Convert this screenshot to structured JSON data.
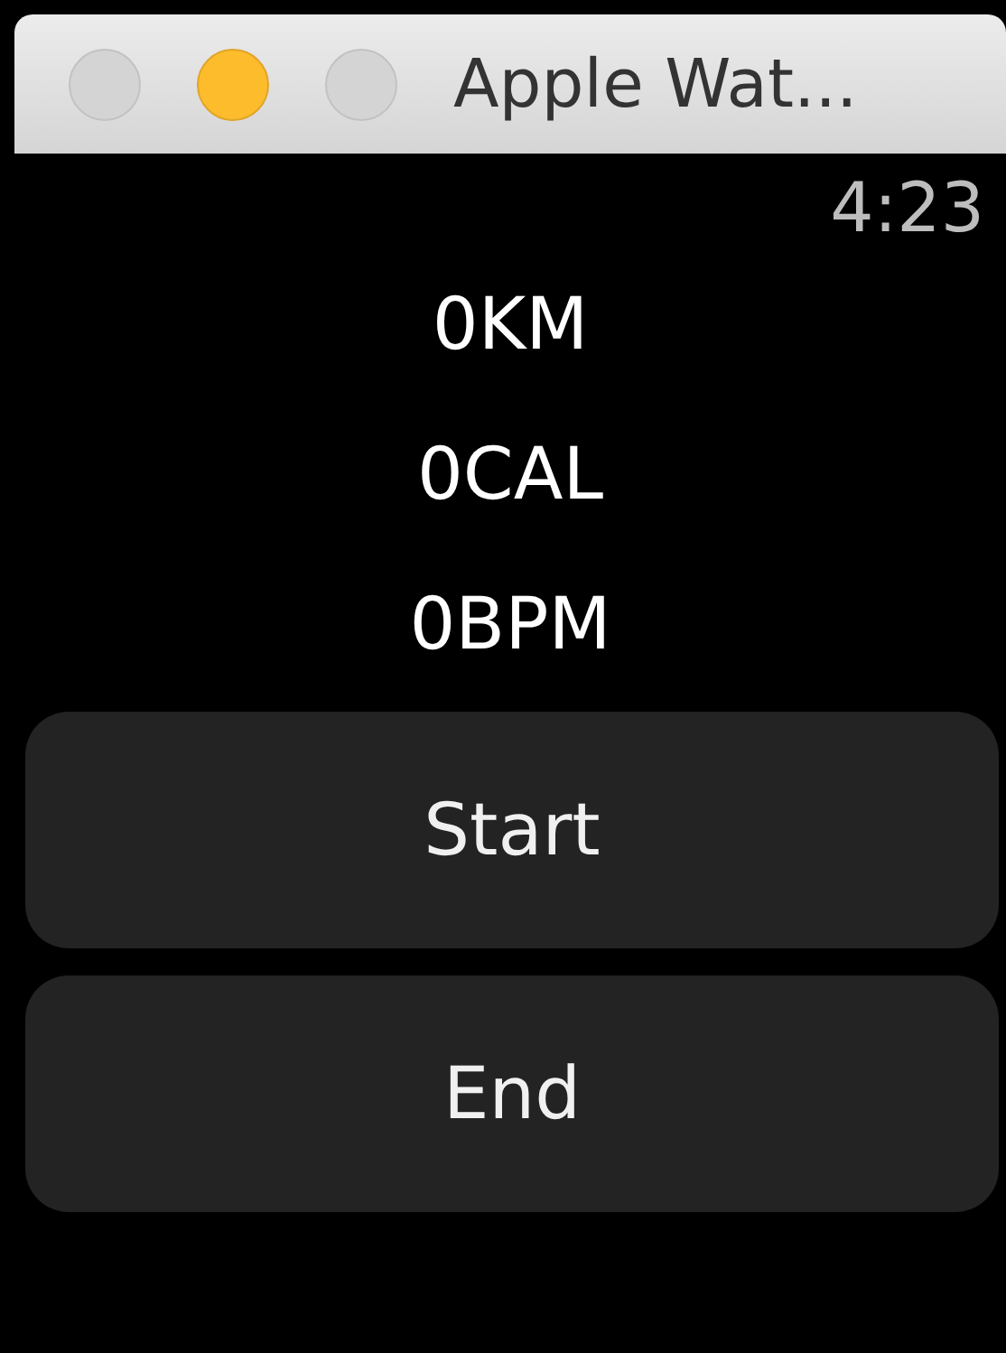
{
  "window": {
    "title": "Apple Wat...",
    "buttons": [
      {
        "kind": "close",
        "enabled": false
      },
      {
        "kind": "minimize",
        "enabled": true
      },
      {
        "kind": "zoom",
        "enabled": false
      }
    ]
  },
  "time": "4:23",
  "stats": [
    "0KM",
    "0CAL",
    "0BPM"
  ],
  "buttons": [
    "Start",
    "End"
  ]
}
